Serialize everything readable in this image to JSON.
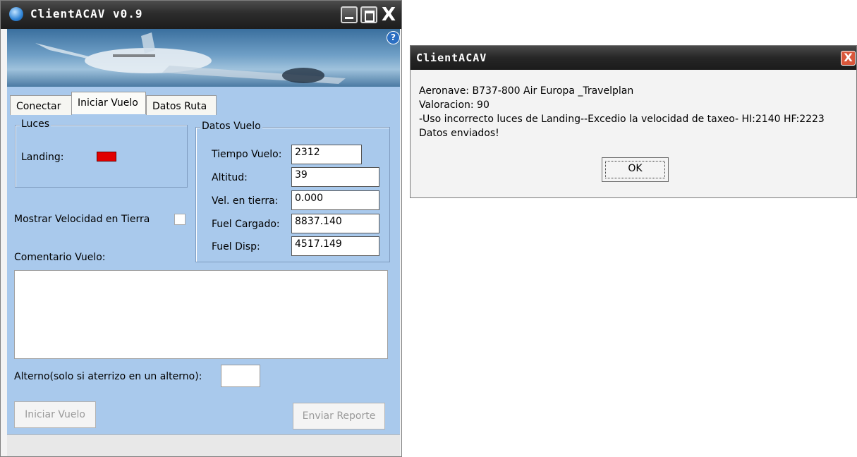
{
  "main_window": {
    "title": "ClientACAV v0.9",
    "help_icon": "?",
    "close_glyph": "X",
    "tabs": [
      {
        "label": "Conectar"
      },
      {
        "label": "Iniciar Vuelo"
      },
      {
        "label": "Datos Ruta"
      }
    ],
    "luces": {
      "title": "Luces",
      "landing_label": "Landing:",
      "landing_color": "#e10000"
    },
    "mostrar_velocidad_label": "Mostrar Velocidad en Tierra",
    "datos_vuelo": {
      "title": "Datos Vuelo",
      "fields": [
        {
          "label": "Tiempo Vuelo:",
          "value": "2312"
        },
        {
          "label": "Altitud:",
          "value": "39"
        },
        {
          "label": "Vel. en tierra:",
          "value": "0.000"
        },
        {
          "label": "Fuel Cargado:",
          "value": "8837.140"
        },
        {
          "label": "Fuel Disp:",
          "value": "4517.149"
        }
      ]
    },
    "comentario_label": "Comentario Vuelo:",
    "comentario_value": "",
    "alterno_label": "Alterno(solo si aterrizo en un alterno):",
    "alterno_value": "",
    "buttons": {
      "iniciar": "Iniciar Vuelo",
      "enviar": "Enviar Reporte"
    }
  },
  "dialog": {
    "title": "ClientACAV",
    "close_glyph": "X",
    "lines": [
      "Aeronave: B737-800 Air Europa _Travelplan",
      "Valoracion: 90",
      "-Uso incorrecto luces de Landing--Excedio la velocidad de taxeo- HI:2140 HF:2223",
      "Datos enviados!"
    ],
    "ok_label": "OK"
  }
}
